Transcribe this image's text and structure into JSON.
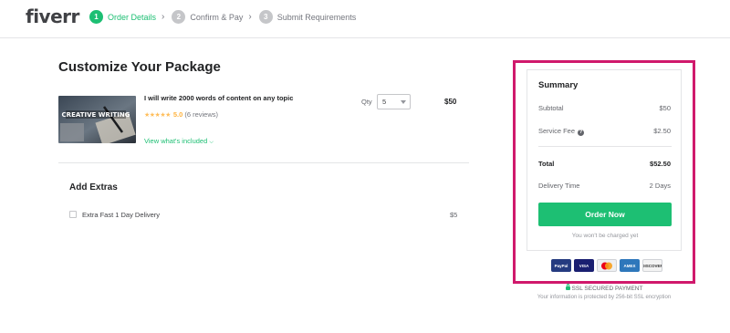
{
  "header": {
    "logo": "fiverr",
    "steps": [
      {
        "number": "1",
        "label": "Order Details",
        "active": true
      },
      {
        "number": "2",
        "label": "Confirm & Pay",
        "active": false
      },
      {
        "number": "3",
        "label": "Submit Requirements",
        "active": false
      }
    ]
  },
  "main": {
    "title": "Customize Your Package",
    "gig": {
      "title": "I will write 2000 words of content on any topic",
      "thumbnail_text": "CREATIVE WRITING",
      "rating": "5.0",
      "reviews": "(6 reviews)",
      "view_link": "View what's included",
      "qty_label": "Qty",
      "qty_value": "5",
      "price": "$50"
    },
    "extras": {
      "title": "Add Extras",
      "items": [
        {
          "label": "Extra Fast 1 Day Delivery",
          "price": "$5",
          "checked": false
        }
      ]
    }
  },
  "summary": {
    "title": "Summary",
    "subtotal_label": "Subtotal",
    "subtotal_value": "$50",
    "fee_label": "Service Fee",
    "fee_value": "$2.50",
    "total_label": "Total",
    "total_value": "$52.50",
    "delivery_label": "Delivery Time",
    "delivery_value": "2 Days",
    "order_button": "Order Now",
    "charge_note": "You won't be charged yet",
    "payment_methods": [
      "PayPal",
      "VISA",
      "MasterCard",
      "AMEX",
      "DISCOVER"
    ],
    "ssl_label": "SSL SECURED PAYMENT",
    "ssl_note": "Your information is protected by 256-bit SSL encryption"
  },
  "colors": {
    "brand_green": "#1dbf73",
    "highlight_border": "#d0196c",
    "star": "#ffbe5b"
  }
}
